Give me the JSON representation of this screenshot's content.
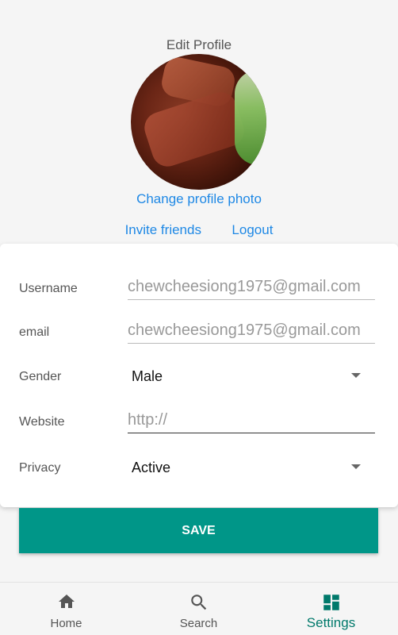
{
  "header": {
    "title": "Edit Profile"
  },
  "profile": {
    "change_photo_label": "Change profile photo",
    "invite_label": "Invite friends",
    "logout_label": "Logout"
  },
  "form": {
    "username_label": "Username",
    "username_value": "chewcheesiong1975@gmail.com",
    "email_label": "email",
    "email_value": "chewcheesiong1975@gmail.com",
    "gender_label": "Gender",
    "gender_value": "Male",
    "website_label": "Website",
    "website_placeholder": "http://",
    "privacy_label": "Privacy",
    "privacy_value": "Active"
  },
  "save_label": "SAVE",
  "tabs": [
    {
      "label": "Home",
      "icon": "home-icon"
    },
    {
      "label": "Search",
      "icon": "search-icon"
    },
    {
      "label": "Settings",
      "icon": "dashboard-icon"
    }
  ],
  "colors": {
    "accent": "#009688",
    "link": "#1e88e5",
    "active_tab": "#00796b"
  }
}
